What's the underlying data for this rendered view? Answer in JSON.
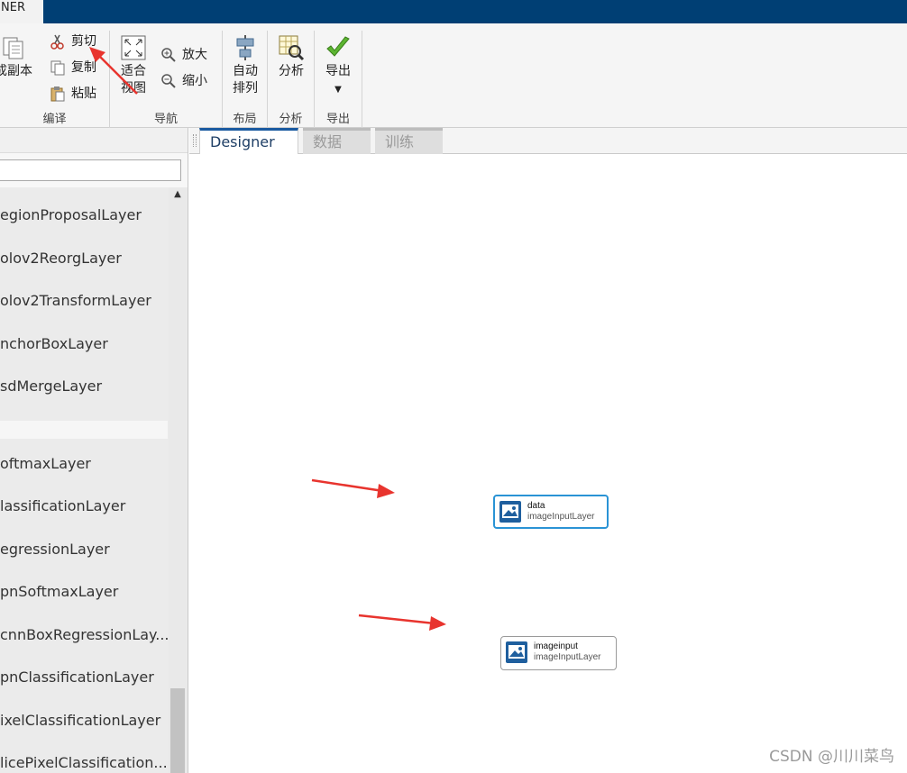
{
  "app_tab": {
    "label": "NER"
  },
  "ribbon": {
    "groups": {
      "compile": {
        "label": "编译",
        "duplicate_label": "成副本",
        "cut_label": "剪切",
        "copy_label": "复制",
        "paste_label": "粘贴"
      },
      "navigate": {
        "label": "导航",
        "fit_line1": "适合",
        "fit_line2": "视图",
        "zoom_in_label": "放大",
        "zoom_out_label": "缩小"
      },
      "layout": {
        "label": "布局",
        "auto_line1": "自动",
        "auto_line2": "排列"
      },
      "analyze": {
        "label": "分析",
        "analyze_label": "分析"
      },
      "export": {
        "label": "导出",
        "export_label": "导出"
      }
    }
  },
  "left_panel": {
    "items_top": [
      "egionProposalLayer",
      "olov2ReorgLayer",
      "olov2TransformLayer",
      "nchorBoxLayer",
      "sdMergeLayer"
    ],
    "items_bottom": [
      "oftmaxLayer",
      "lassificationLayer",
      "egressionLayer",
      "pnSoftmaxLayer",
      "cnnBoxRegressionLay...",
      "pnClassificationLayer",
      "ixelClassificationLayer",
      "licePixelClassification..."
    ]
  },
  "tabs": [
    {
      "label": "Designer",
      "active": true
    },
    {
      "label": "数据",
      "active": false
    },
    {
      "label": "训练",
      "active": false
    }
  ],
  "nodes": [
    {
      "name": "data",
      "type": "imageInputLayer",
      "selected": true
    },
    {
      "name": "imageinput",
      "type": "imageInputLayer",
      "selected": false
    }
  ],
  "colors": {
    "titlebar": "#003f74",
    "accent": "#1a5aa0",
    "selection": "#2a93d5",
    "annotation_arrow": "#e8342e"
  },
  "watermark": "CSDN @川川菜鸟"
}
